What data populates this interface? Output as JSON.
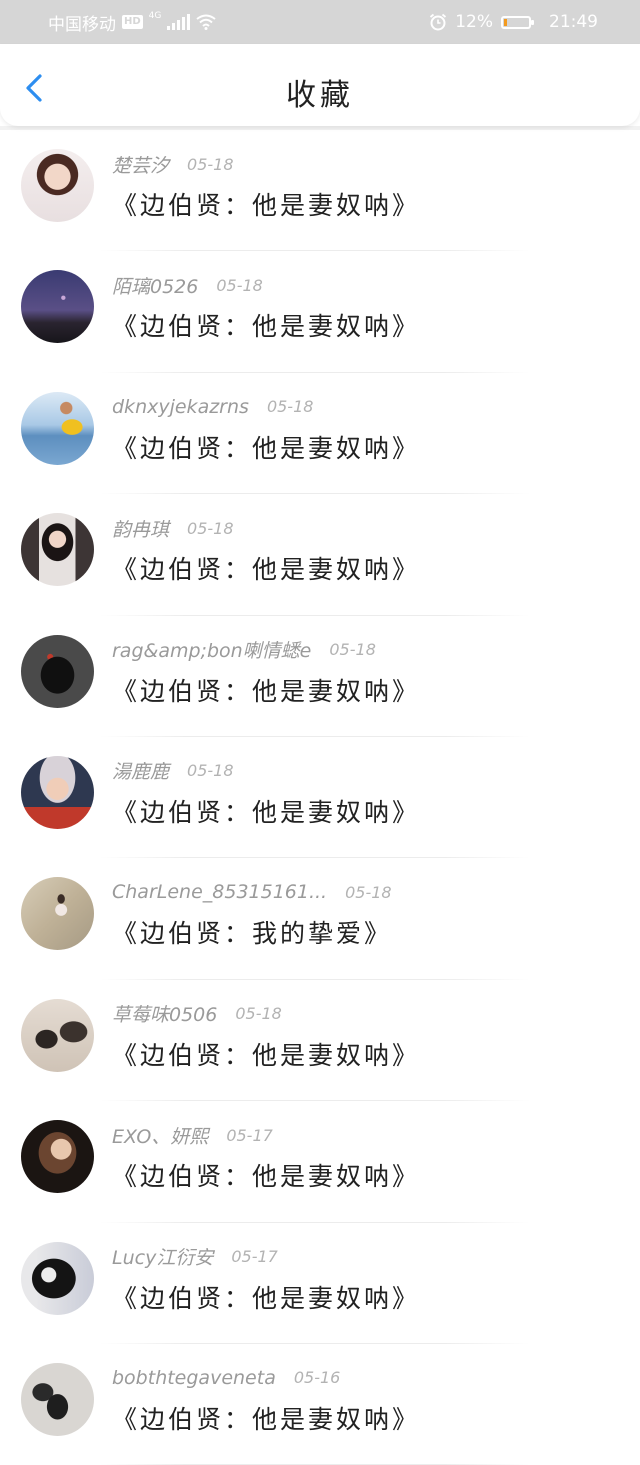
{
  "status_bar": {
    "carrier": "中国移动",
    "hd_badge": "HD",
    "network": "4G",
    "battery_percent_text": "12%",
    "battery_level": 0.12,
    "battery_color": "#f39a1e",
    "time": "21:49",
    "icons": [
      "signal-icon",
      "wifi-icon",
      "alarm-icon",
      "battery-icon"
    ]
  },
  "nav": {
    "title": "收藏",
    "back_icon": "chevron-left-icon",
    "accent_color": "#2d8ef0"
  },
  "items": [
    {
      "username": "楚芸汐",
      "date": "05-18",
      "title": "《边伯贤：他是妻奴呐》"
    },
    {
      "username": "陌璃0526",
      "date": "05-18",
      "title": "《边伯贤：他是妻奴呐》"
    },
    {
      "username": "dknxyjekazrns",
      "date": "05-18",
      "title": "《边伯贤：他是妻奴呐》"
    },
    {
      "username": "韵冉琪",
      "date": "05-18",
      "title": "《边伯贤：他是妻奴呐》"
    },
    {
      "username": "rag&amp;bon喇情蟋e",
      "date": "05-18",
      "title": "《边伯贤：他是妻奴呐》"
    },
    {
      "username": "湯鹿鹿",
      "date": "05-18",
      "title": "《边伯贤：他是妻奴呐》"
    },
    {
      "username": "CharLene_85315161...",
      "date": "05-18",
      "title": "《边伯贤：我的挚爱》"
    },
    {
      "username": "草莓味0506",
      "date": "05-18",
      "title": "《边伯贤：他是妻奴呐》"
    },
    {
      "username": "EXO、妍熙",
      "date": "05-17",
      "title": "《边伯贤：他是妻奴呐》"
    },
    {
      "username": "Lucy江衍安",
      "date": "05-17",
      "title": "《边伯贤：他是妻奴呐》"
    },
    {
      "username": "bobthtegaveneta",
      "date": "05-16",
      "title": "《边伯贤：他是妻奴呐》"
    }
  ]
}
